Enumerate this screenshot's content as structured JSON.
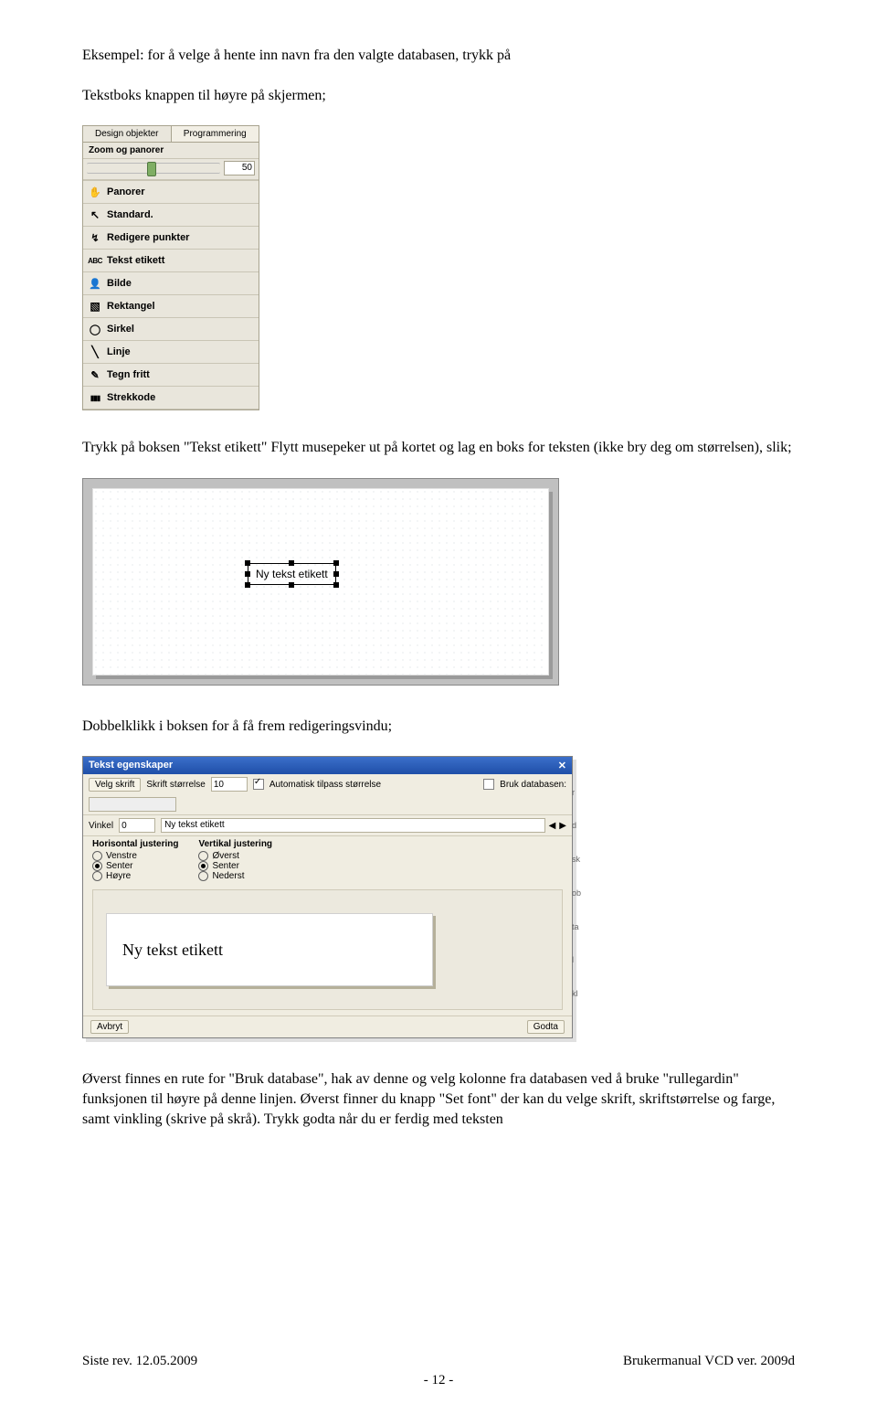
{
  "paragraphs": {
    "p1": "Eksempel: for å velge å hente inn navn fra den valgte databasen, trykk på",
    "p2": "Tekstboks knappen til høyre på skjermen;",
    "p3": "Trykk på boksen \"Tekst etikett\" Flytt musepeker ut på kortet og lag en boks for teksten (ikke bry deg om størrelsen), slik;",
    "p4": "Dobbelklikk i boksen for å få frem redigeringsvindu;",
    "p5": "Øverst finnes en rute for \"Bruk database\", hak av denne og velg kolonne fra databasen ved å bruke \"rullegardin\" funksjonen til høyre på denne linjen. Øverst finner du knapp \"Set font\" der kan du velge skrift, skriftstørrelse og farge, samt vinkling (skrive på skrå). Trykk godta når du er ferdig med teksten"
  },
  "toolbar": {
    "tab1": "Design objekter",
    "tab2": "Programmering",
    "sub": "Zoom og panorer",
    "slider_value": "50",
    "items": [
      {
        "icon": "ico-hand",
        "label": "Panorer"
      },
      {
        "icon": "ico-cursor",
        "label": "Standard."
      },
      {
        "icon": "ico-points",
        "label": "Redigere punkter"
      },
      {
        "icon": "ico-text",
        "label": "Tekst etikett"
      },
      {
        "icon": "ico-image",
        "label": "Bilde"
      },
      {
        "icon": "ico-rect",
        "label": "Rektangel"
      },
      {
        "icon": "ico-circle",
        "label": "Sirkel"
      },
      {
        "icon": "ico-line",
        "label": "Linje"
      },
      {
        "icon": "ico-free",
        "label": "Tegn fritt"
      },
      {
        "icon": "ico-barcode",
        "label": "Strekkode"
      }
    ]
  },
  "canvas": {
    "textobj": "Ny tekst etikett"
  },
  "editor": {
    "title": "Tekst egenskaper",
    "set_font": "Velg skrift",
    "font_size_label": "Skrift størrelse",
    "font_size_value": "10",
    "angle_label": "Vinkel",
    "angle_value": "0",
    "autosize_label": "Automatisk tilpass størrelse",
    "use_db_label": "Bruk databasen:",
    "mid_value": "Ny tekst etikett",
    "hjust_header": "Horisontal justering",
    "hjust_options": [
      "Venstre",
      "Senter",
      "Høyre"
    ],
    "vjust_header": "Vertikal justering",
    "vjust_options": [
      "Øverst",
      "Senter",
      "Nederst"
    ],
    "preview_text": "Ny tekst etikett",
    "cancel": "Avbryt",
    "accept": "Godta"
  },
  "footer": {
    "left": "Siste rev. 12.05.2009",
    "right": "Brukermanual VCD ver. 2009d",
    "page": "- 12 -"
  }
}
